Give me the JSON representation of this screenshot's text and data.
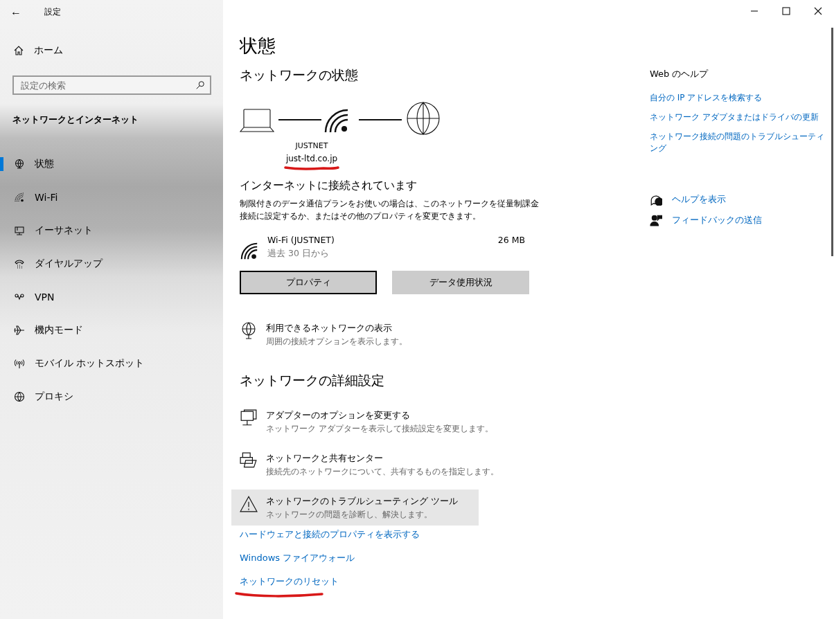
{
  "window": {
    "title": "設定",
    "back": "←"
  },
  "sidebar": {
    "home": "ホーム",
    "search": {
      "placeholder": "設定の検索"
    },
    "section": "ネットワークとインターネット",
    "items": [
      {
        "label": "状態",
        "selected": true
      },
      {
        "label": "Wi-Fi",
        "selected": false
      },
      {
        "label": "イーサネット",
        "selected": false
      },
      {
        "label": "ダイヤルアップ",
        "selected": false
      },
      {
        "label": "VPN",
        "selected": false
      },
      {
        "label": "機内モード",
        "selected": false
      },
      {
        "label": "モバイル ホットスポット",
        "selected": false
      },
      {
        "label": "プロキシ",
        "selected": false
      }
    ]
  },
  "page_title": "状態",
  "status_heading": "ネットワークの状態",
  "network": {
    "name": "JUSTNET",
    "domain": "just-ltd.co.jp"
  },
  "connection": {
    "title": "インターネットに接続されています",
    "description": "制限付きのデータ通信プランをお使いの場合は、このネットワークを従量制課金接続に設定するか、またはその他のプロパティを変更できます。"
  },
  "usage": {
    "name": "Wi-Fi (JUSTNET)",
    "period": "過去 30 日から",
    "amount": "26 MB"
  },
  "buttons": [
    {
      "label": "プロパティ",
      "focused": true
    },
    {
      "label": "データ使用状況",
      "focused": false
    }
  ],
  "show_networks": {
    "title": "利用できるネットワークの表示",
    "subtitle": "周囲の接続オプションを表示します。"
  },
  "advanced_heading": "ネットワークの詳細設定",
  "advanced_items": [
    {
      "title": "アダプターのオプションを変更する",
      "subtitle": "ネットワーク アダプターを表示して接続設定を変更します。",
      "hovered": false
    },
    {
      "title": "ネットワークと共有センター",
      "subtitle": "接続先のネットワークについて、共有するものを指定します。",
      "hovered": false
    },
    {
      "title": "ネットワークのトラブルシューティング ツール",
      "subtitle": "ネットワークの問題を診断し、解決します。",
      "hovered": true
    }
  ],
  "links": [
    "ハードウェアと接続のプロパティを表示する",
    "Windows ファイアウォール",
    "ネットワークのリセット"
  ],
  "help": {
    "heading": "Web のヘルプ",
    "links": [
      "自分の IP アドレスを検索する",
      "ネットワーク アダプタまたはドライバの更新",
      "ネットワーク接続の問題のトラブルシューティング"
    ],
    "actions": [
      "ヘルプを表示",
      "フィードバックの送信"
    ]
  }
}
